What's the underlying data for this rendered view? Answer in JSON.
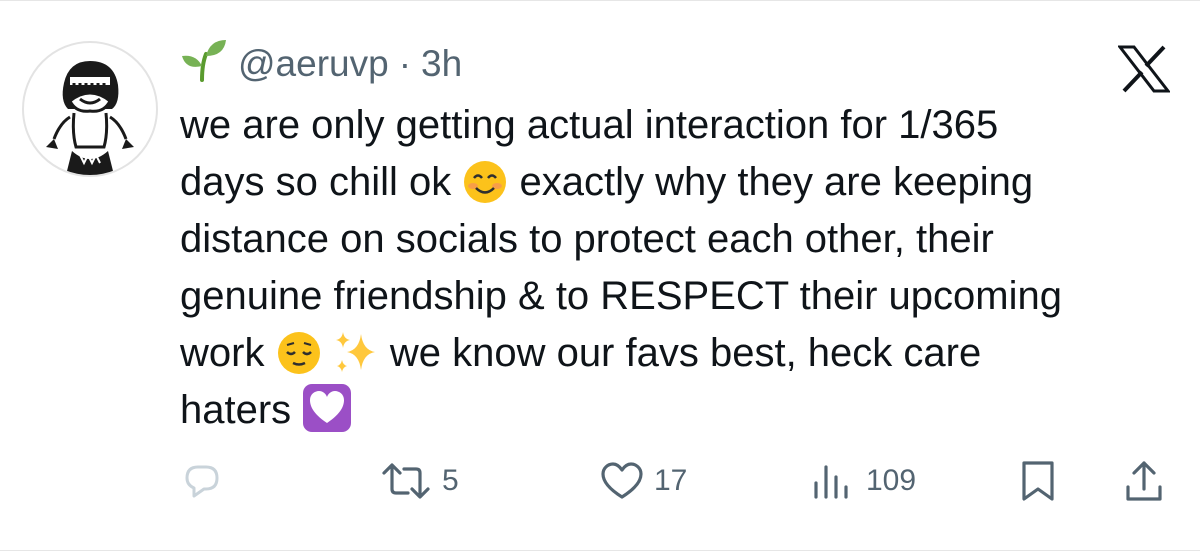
{
  "post": {
    "handle": "@aeruvp",
    "separator": "·",
    "time": "3h",
    "text": {
      "line1": "we are only getting actual interaction for 1/365",
      "line2a": "days so chill ok",
      "line2b": "exactly why they are keeping",
      "line3": "distance on socials to protect each other, their",
      "line4": "genuine friendship & to RESPECT their upcoming",
      "line5a": "work",
      "line5b": "we know our favs best, heck care",
      "line6": "haters"
    },
    "emojis": [
      "smiling-face-emoji",
      "relieved-face-emoji",
      "sparkles-emoji",
      "purple-heart-emoji"
    ]
  },
  "actions": {
    "reposts": "5",
    "likes": "17",
    "views": "109"
  },
  "icons": {
    "name_emoji": "seedling-icon",
    "platform": "x-logo-icon",
    "reply": "reply-icon",
    "repost": "repost-icon",
    "like": "heart-icon",
    "views": "views-icon",
    "bookmark": "bookmark-icon",
    "share": "share-icon"
  },
  "colors": {
    "text": "#0f1419",
    "secondary": "#536471",
    "reply_faded": "#c9d3da"
  }
}
